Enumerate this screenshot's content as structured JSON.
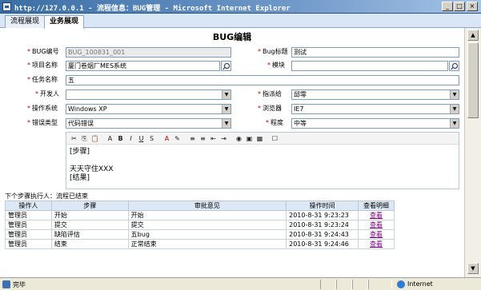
{
  "window": {
    "title": "http://127.0.0.1 - 流程信息：BUG管理 - Microsoft Internet Explorer",
    "min": "_",
    "max": "□",
    "close": "×"
  },
  "tabs": [
    {
      "label": "流程展现"
    },
    {
      "label": "业务展现"
    }
  ],
  "form": {
    "title": "BUG编辑",
    "req_mark": "*",
    "bug_no": {
      "label": "BUG编号",
      "value": "BUG_100831_001"
    },
    "bug_title": {
      "label": "Bug标题",
      "value": "测试"
    },
    "project": {
      "label": "项目名称",
      "value": "厦门卷烟厂MES系统"
    },
    "module": {
      "label": "模块",
      "value": ""
    },
    "task": {
      "label": "任务名称",
      "value": "五"
    },
    "developer": {
      "label": "开发人",
      "value": ""
    },
    "assignee": {
      "label": "指派给",
      "value": "邱零"
    },
    "os": {
      "label": "操作系统",
      "value": "Windows XP"
    },
    "browser": {
      "label": "浏览器",
      "value": "IE7"
    },
    "error_type": {
      "label": "错误类型",
      "value": "代码错误"
    },
    "severity": {
      "label": "程度",
      "value": "中等"
    }
  },
  "editor": {
    "toolbar_icons": [
      "cut-icon",
      "copy-icon",
      "paste-icon",
      "format-icon",
      "bold-icon",
      "italic-icon",
      "underline-icon",
      "strike-icon",
      "font-color-icon",
      "highlight-icon",
      "ordered-list-icon",
      "unordered-list-icon",
      "outdent-icon",
      "indent-icon",
      "link-icon",
      "image-icon",
      "table-icon",
      "checkbox-icon"
    ],
    "toolbar_glyphs": [
      "✂",
      "⎘",
      "📋",
      "A",
      "B",
      "I",
      "U",
      "S",
      "A",
      "✎",
      "≡",
      "≡",
      "⇤",
      "⇥",
      "◉",
      "▣",
      "▦",
      "☐"
    ],
    "lines": [
      "[步骤]",
      "",
      "天天守住XXX",
      "[结果]"
    ]
  },
  "next_step": "下个步骤执行人：流程已结束",
  "grid": {
    "headers": [
      "操作人",
      "步骤",
      "审批意见",
      "操作时间",
      "查看明细"
    ],
    "rows": [
      [
        "管理员",
        "开始",
        "开始",
        "2010-8-31 9:23:23",
        "查看"
      ],
      [
        "管理员",
        "提交",
        "提交",
        "2010-8-31 9:23:24",
        "查看"
      ],
      [
        "管理员",
        "缺陷评估",
        "五bug",
        "2010-8-31 9:24:43",
        "查看"
      ],
      [
        "管理员",
        "结束",
        "正常结束",
        "2010-8-31 9:24:46",
        "查看"
      ]
    ]
  },
  "statusbar": {
    "text": "完毕",
    "zone": "Internet"
  }
}
